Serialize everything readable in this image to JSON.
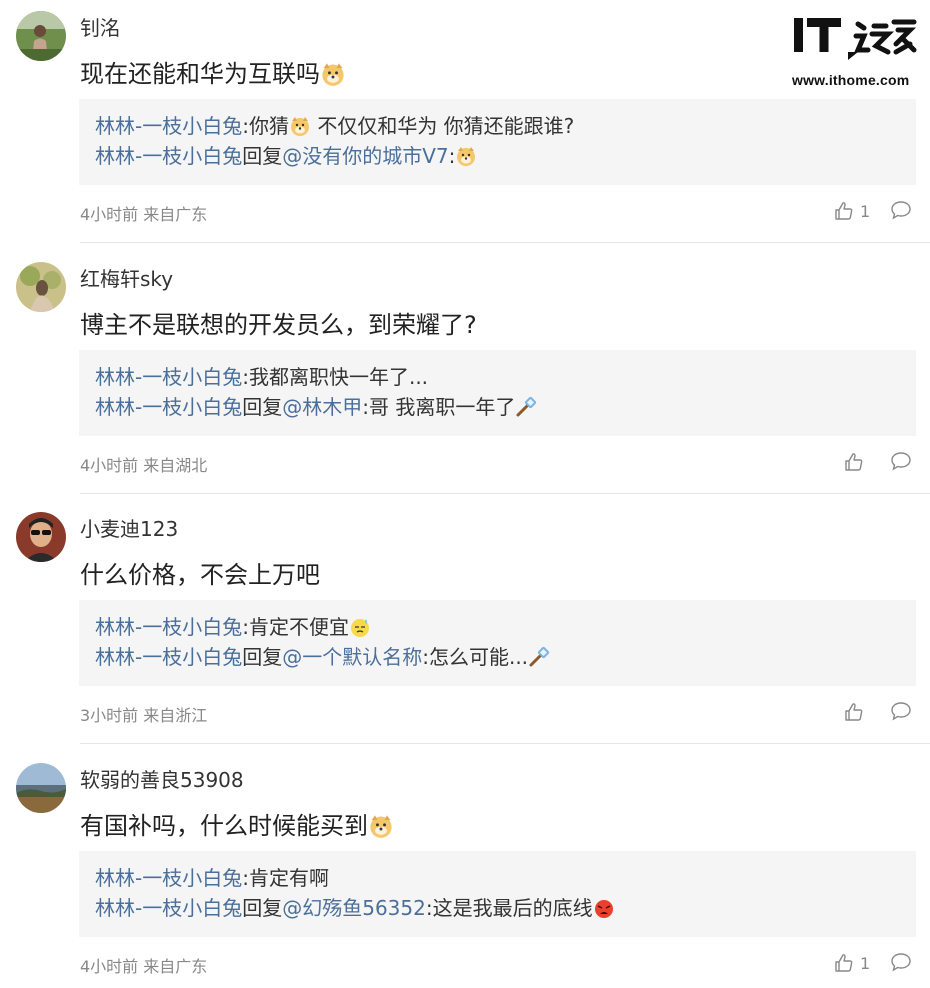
{
  "logo": {
    "brand": "IT之家",
    "url": "www.ithome.com"
  },
  "comments": [
    {
      "username": "钊洺",
      "content": "现在还能和华为互联吗",
      "content_emoji": "doge",
      "replies": [
        {
          "name": "林林-一枝小白兔",
          "pre": ":你猜",
          "emoji": "doge",
          "post": " 不仅仅和华为 你猜还能跟谁?"
        },
        {
          "name": "林林-一枝小白兔",
          "pre": "回复",
          "at": "@没有你的城市V7",
          "post2": ":",
          "emoji2": "doge"
        }
      ],
      "meta": "4小时前 来自广东",
      "likes": "1"
    },
    {
      "username": "红梅轩sky",
      "content": "博主不是联想的开发员么，到荣耀了?",
      "replies": [
        {
          "name": "林林-一枝小白兔",
          "pre": ":我都离职快一年了..."
        },
        {
          "name": "林林-一枝小白兔",
          "pre": "回复",
          "at": "@林木甲",
          "post2": ":哥 我离职一年了",
          "emoji2": "hammer"
        }
      ],
      "meta": "4小时前 来自湖北",
      "likes": ""
    },
    {
      "username": "小麦迪123",
      "content": "什么价格，不会上万吧",
      "replies": [
        {
          "name": "林林-一枝小白兔",
          "pre": ":肯定不便宜",
          "emoji": "sweat"
        },
        {
          "name": "林林-一枝小白兔",
          "pre": "回复",
          "at": "@一个默认名称",
          "post2": ":怎么可能...",
          "emoji2": "hammer"
        }
      ],
      "meta": "3小时前 来自浙江",
      "likes": ""
    },
    {
      "username": "软弱的善良53908",
      "content": "有国补吗，什么时候能买到",
      "content_emoji": "doge",
      "replies": [
        {
          "name": "林林-一枝小白兔",
          "pre": ":肯定有啊"
        },
        {
          "name": "林林-一枝小白兔",
          "pre": "回复",
          "at": "@幻殇鱼56352",
          "post2": ":这是我最后的底线",
          "emoji2": "angry"
        }
      ],
      "meta": "4小时前 来自广东",
      "likes": "1"
    }
  ],
  "colors": {
    "link": "#4b6f9b",
    "reply_bg": "#f5f5f5",
    "meta": "#888888"
  }
}
